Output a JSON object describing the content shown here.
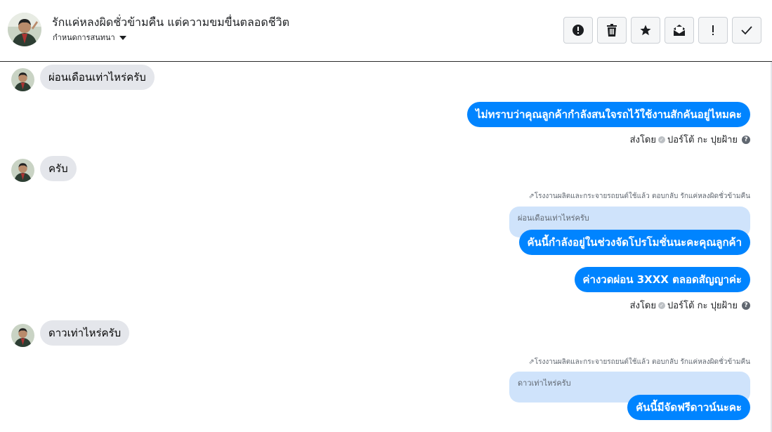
{
  "header": {
    "title": "รักแค่หลงผิดชั่วข้ามคืน แต่ความขมขื่นตลอดชีวิต",
    "subtitle": "กำหนดการสนทนา",
    "toolbar": [
      {
        "name": "spam-button",
        "icon": "alert-circle-icon"
      },
      {
        "name": "delete-button",
        "icon": "trash-icon"
      },
      {
        "name": "star-button",
        "icon": "star-icon"
      },
      {
        "name": "mark-unread-button",
        "icon": "envelope-icon"
      },
      {
        "name": "follow-up-button",
        "icon": "exclamation-icon"
      },
      {
        "name": "done-button",
        "icon": "check-icon"
      }
    ]
  },
  "messages": {
    "m1": "ผ่อนเดือนเท่าไหร่ครับ",
    "m2": "ไม่ทราบว่าคุณลูกค้ากำลังสนใจรถไว้ใช้งานสักคันอยู่ไหมคะ",
    "sent1_prefix": "ส่งโดย",
    "sent1_name": "ปอร์โต้ กะ ปุยฝ้าย",
    "m3": "ครับ",
    "reply1_note": "โรงงานผลิตและกระจายรถยนต์ใช้แล้ว ตอบกลับ รักแค่หลงผิดชั่วข้ามคืน",
    "reply1_quote": "ผ่อนเดือนเท่าไหร่ครับ",
    "m4": "คันนี้กำลังอยู่ในช่วงจัดโปรโมชั่นนะคะคุณลูกค้า",
    "m5": "ค่างวดผ่อน 3XXX ตลอดสัญญาค่ะ",
    "sent2_prefix": "ส่งโดย",
    "sent2_name": "ปอร์โต้ กะ ปุยฝ้าย",
    "m6": "ดาวเท่าไหร่ครับ",
    "reply2_note": "โรงงานผลิตและกระจายรถยนต์ใช้แล้ว ตอบกลับ รักแค่หลงผิดชั่วข้ามคืน",
    "reply2_quote": "ดาวเท่าไหร่ครับ",
    "m7": "คันนี้มีจัดฟรีดาวน์นะคะ"
  },
  "colors": {
    "outgoing_bubble": "#0084ff",
    "incoming_bubble": "#e4e6eb",
    "quote_bg": "#cfe3fb"
  }
}
